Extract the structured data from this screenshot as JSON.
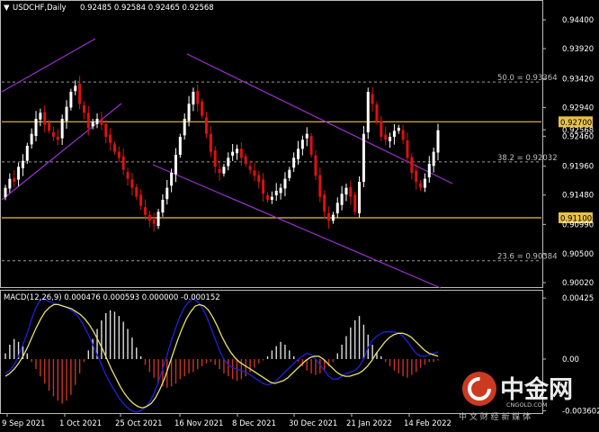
{
  "header": {
    "arrow": "▼",
    "symbol": "USDCHF,Daily",
    "ohlc": "0.92485 0.92584 0.92465 0.92568"
  },
  "macd": {
    "label": "MACD(12,26,9) 0.000476 0.000593 0.000000 -0.000152"
  },
  "watermark": {
    "brand_cn": "中金网",
    "brand_en": "CNGOLD.COM",
    "slogan": "中 文 财 经 新 媒 体"
  },
  "colors": {
    "background": "#000000",
    "bull": "#ffffff",
    "bear": "#dd1111",
    "channel": "#9b30d0",
    "level": "#e8c048",
    "fib": "#9a9a9a",
    "grid": "#555555",
    "macd_line": "#2020dd",
    "signal_line": "#e8e070",
    "hist_pos": "#dddddd",
    "hist_neg": "#cc3322"
  },
  "chart_data": {
    "type": "candlestick",
    "symbol": "USDCHF",
    "timeframe": "Daily",
    "y_ticks": [
      "0.94400",
      "0.93920",
      "0.93420",
      "0.92940",
      "0.92460",
      "0.91960",
      "0.91480",
      "0.90990",
      "0.90500",
      "0.90020"
    ],
    "ylim": [
      0.8996,
      0.947
    ],
    "x_ticks": [
      "9 Sep 2021",
      "1 Oct 2021",
      "25 Oct 2021",
      "16 Nov 2021",
      "8 Dec 2021",
      "30 Dec 2021",
      "21 Jan 2022",
      "14 Feb 2022"
    ],
    "horizontal_levels": [
      {
        "value": 0.927,
        "label": "0.92700"
      },
      {
        "value": 0.911,
        "label": "0.91100"
      }
    ],
    "current_price": {
      "value": 0.92568,
      "label": "0.92568"
    },
    "fibonacci": [
      {
        "label": "50.0 = 0.93364",
        "value": 0.93364
      },
      {
        "label": "38.2 = 0.92032",
        "value": 0.92032
      },
      {
        "label": "23.6 = 0.90384",
        "value": 0.90384
      }
    ],
    "closes": [
      0.916,
      0.9175,
      0.917,
      0.9195,
      0.9205,
      0.923,
      0.925,
      0.9275,
      0.9285,
      0.9265,
      0.9255,
      0.9245,
      0.924,
      0.9275,
      0.9295,
      0.932,
      0.933,
      0.93,
      0.9285,
      0.926,
      0.927,
      0.9275,
      0.9265,
      0.9245,
      0.9235,
      0.922,
      0.921,
      0.919,
      0.9175,
      0.916,
      0.9145,
      0.913,
      0.9115,
      0.9105,
      0.91,
      0.912,
      0.914,
      0.916,
      0.9185,
      0.9215,
      0.9245,
      0.9275,
      0.93,
      0.932,
      0.93,
      0.928,
      0.925,
      0.922,
      0.9195,
      0.9185,
      0.9195,
      0.921,
      0.922,
      0.9225,
      0.921,
      0.92,
      0.919,
      0.918,
      0.917,
      0.915,
      0.914,
      0.9145,
      0.9155,
      0.916,
      0.9175,
      0.919,
      0.921,
      0.9225,
      0.924,
      0.925,
      0.9215,
      0.918,
      0.9145,
      0.912,
      0.9105,
      0.9115,
      0.9135,
      0.915,
      0.916,
      0.9145,
      0.912,
      0.917,
      0.925,
      0.932,
      0.93,
      0.927,
      0.9245,
      0.924,
      0.9245,
      0.9255,
      0.926,
      0.924,
      0.921,
      0.9185,
      0.917,
      0.916,
      0.9175,
      0.92,
      0.922,
      0.9256
    ],
    "macd_ylim": [
      -0.0037,
      0.0047
    ],
    "macd_ticks": [
      "0.00425",
      "0.00",
      "-0.003602"
    ],
    "macd_series": [
      {
        "name": "MACD",
        "values": [
          -0.001,
          -0.0008,
          -0.0004,
          0.0002,
          0.001,
          0.0018,
          0.0028,
          0.0036,
          0.0041,
          0.0042,
          0.004,
          0.0039,
          0.0038,
          0.0037,
          0.0036,
          0.0034,
          0.0032,
          0.0028,
          0.0023,
          0.0017,
          0.001,
          0.0003,
          -0.0004,
          -0.0011,
          -0.0017,
          -0.0022,
          -0.0027,
          -0.0031,
          -0.0034,
          -0.0036,
          -0.0037,
          -0.0036,
          -0.0034,
          -0.003,
          -0.0024,
          -0.0016,
          -0.0007,
          0.0003,
          0.0013,
          0.0022,
          0.003,
          0.0036,
          0.004,
          0.0042,
          0.004,
          0.0036,
          0.003,
          0.0022,
          0.0014,
          0.0006,
          0.0,
          -0.0004,
          -0.0006,
          -0.0007,
          -0.0008,
          -0.0009,
          -0.0011,
          -0.0013,
          -0.0015,
          -0.0017,
          -0.0018,
          -0.0017,
          -0.0015,
          -0.0012,
          -0.0009,
          -0.0006,
          -0.0003,
          0.0,
          0.0002,
          0.0004,
          0.0003,
          0.0,
          -0.0004,
          -0.0008,
          -0.0012,
          -0.0014,
          -0.0014,
          -0.0012,
          -0.001,
          -0.0009,
          -0.0008,
          -0.0005,
          0.0,
          0.0008,
          0.0013,
          0.0016,
          0.0018,
          0.0019,
          0.0019,
          0.0019,
          0.0018,
          0.0016,
          0.0012,
          0.0008,
          0.0004,
          0.0002,
          0.0002,
          0.0003,
          0.0004,
          0.0005
        ]
      },
      {
        "name": "Signal",
        "values": [
          -0.0012,
          -0.001,
          -0.0007,
          -0.0003,
          0.0002,
          0.0008,
          0.0015,
          0.0022,
          0.0028,
          0.0033,
          0.0036,
          0.0038,
          0.0038,
          0.0037,
          0.0036,
          0.0035,
          0.0033,
          0.0031,
          0.0028,
          0.0024,
          0.0019,
          0.0013,
          0.0007,
          0.0,
          -0.0007,
          -0.0013,
          -0.0019,
          -0.0024,
          -0.0028,
          -0.0031,
          -0.0033,
          -0.0034,
          -0.0033,
          -0.0031,
          -0.0027,
          -0.0021,
          -0.0014,
          -0.0005,
          0.0004,
          0.0013,
          0.0021,
          0.0028,
          0.0033,
          0.0037,
          0.0038,
          0.0037,
          0.0034,
          0.0029,
          0.0023,
          0.0016,
          0.001,
          0.0005,
          0.0001,
          -0.0002,
          -0.0004,
          -0.0006,
          -0.0008,
          -0.001,
          -0.0012,
          -0.0014,
          -0.0016,
          -0.0017,
          -0.0016,
          -0.0015,
          -0.0013,
          -0.001,
          -0.0007,
          -0.0004,
          -0.0001,
          0.0001,
          0.0002,
          0.0002,
          0.0,
          -0.0003,
          -0.0006,
          -0.0009,
          -0.0011,
          -0.0012,
          -0.0012,
          -0.0011,
          -0.001,
          -0.0008,
          -0.0005,
          -0.0001,
          0.0004,
          0.0008,
          0.0012,
          0.0015,
          0.0017,
          0.0018,
          0.0018,
          0.0017,
          0.0015,
          0.0012,
          0.0009,
          0.0006,
          0.0004,
          0.0003,
          0.0002
        ]
      }
    ],
    "macd_hist": [
      0.0004,
      0.001,
      0.0014,
      0.0012,
      0.0009,
      0.0004,
      -0.0002,
      -0.0007,
      -0.0012,
      -0.0017,
      -0.0022,
      -0.0026,
      -0.0029,
      -0.0031,
      -0.0029,
      -0.0025,
      -0.0018,
      -0.001,
      -0.0002,
      0.0006,
      0.0014,
      0.0021,
      0.0027,
      0.0032,
      0.0034,
      0.0033,
      0.003,
      0.0026,
      0.0021,
      0.0015,
      0.0008,
      0.0002,
      -0.0004,
      -0.0009,
      -0.0013,
      -0.0017,
      -0.0019,
      -0.002,
      -0.0019,
      -0.0017,
      -0.0014,
      -0.0012,
      -0.001,
      -0.0009,
      -0.0007,
      -0.0005,
      -0.0003,
      -0.0002,
      -0.0004,
      -0.0007,
      -0.001,
      -0.0012,
      -0.0014,
      -0.0015,
      -0.0014,
      -0.0012,
      -0.0009,
      -0.0006,
      -0.0003,
      -0.0001,
      0.0002,
      0.0006,
      0.0009,
      0.0012,
      0.001,
      0.0006,
      0.0002,
      -0.0002,
      -0.0005,
      -0.0008,
      -0.001,
      -0.0011,
      -0.001,
      -0.0008,
      -0.0005,
      -0.0002,
      0.0004,
      0.001,
      0.0016,
      0.0022,
      0.0027,
      0.003,
      0.0024,
      0.0017,
      0.001,
      0.0005,
      0.0002,
      -0.0002,
      -0.0005,
      -0.0008,
      -0.001,
      -0.0012,
      -0.0013,
      -0.0011,
      -0.0009,
      -0.0006,
      -0.0004,
      -0.0002,
      -0.0002,
      -0.0001
    ]
  }
}
